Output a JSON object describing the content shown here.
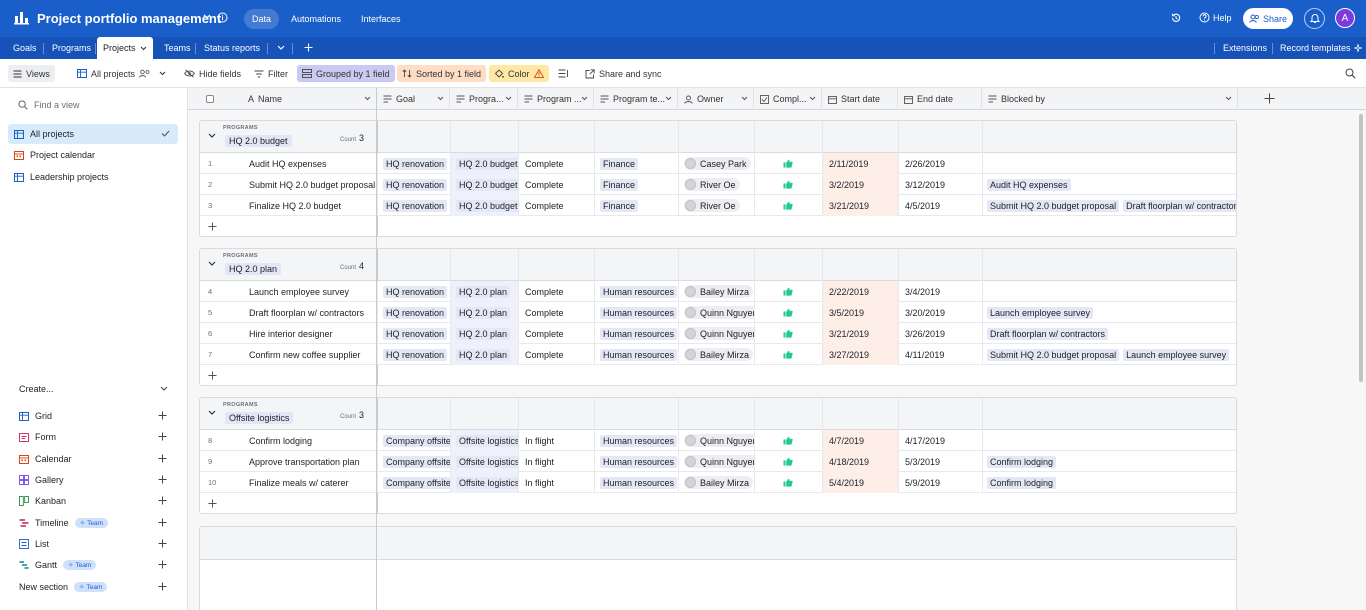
{
  "app": {
    "base_name": "Project portfolio management",
    "top_tabs": [
      "Data",
      "Automations",
      "Interfaces"
    ],
    "help": "Help",
    "share": "Share",
    "avatar_initial": "A",
    "brand_color": "#1a5fc9"
  },
  "table_tabs": {
    "items": [
      "Goals",
      "Programs",
      "Projects",
      "Teams",
      "Status reports"
    ],
    "extensions": "Extensions",
    "record_templates": "Record templates"
  },
  "viewbar": {
    "views": "Views",
    "current_view": "All projects",
    "hide_fields": "Hide fields",
    "filter": "Filter",
    "grouped": "Grouped by 1 field",
    "sorted": "Sorted by 1 field",
    "color": "Color",
    "share_sync": "Share and sync"
  },
  "sidebar": {
    "find_placeholder": "Find a view",
    "views": [
      "All projects",
      "Project calendar",
      "Leadership projects"
    ],
    "create_label": "Create...",
    "create_items": [
      "Grid",
      "Form",
      "Calendar",
      "Gallery",
      "Kanban",
      "Timeline",
      "List",
      "Gantt",
      "New section"
    ],
    "team_badge": "Team"
  },
  "columns": [
    "Name",
    "Goal",
    "Progra...",
    "Program ...",
    "Program te...",
    "Owner",
    "Compl...",
    "Start date",
    "End date",
    "Blocked by"
  ],
  "group_type_label": "PROGRAMS",
  "count_label": "Count",
  "groups": [
    {
      "name": "HQ 2.0 budget",
      "count": "3",
      "rows": [
        {
          "num": "1",
          "name": "Audit HQ expenses",
          "goal": "HQ renovation",
          "program": "HQ 2.0 budget",
          "status": "Complete",
          "team": "Finance",
          "owner": "Casey Park",
          "start": "2/11/2019",
          "end": "2/26/2019",
          "blocked": []
        },
        {
          "num": "2",
          "name": "Submit HQ 2.0 budget proposal",
          "goal": "HQ renovation",
          "program": "HQ 2.0 budget",
          "status": "Complete",
          "team": "Finance",
          "owner": "River Oe",
          "start": "3/2/2019",
          "end": "3/12/2019",
          "blocked": [
            "Audit HQ expenses"
          ]
        },
        {
          "num": "3",
          "name": "Finalize HQ 2.0 budget",
          "goal": "HQ renovation",
          "program": "HQ 2.0 budget",
          "status": "Complete",
          "team": "Finance",
          "owner": "River Oe",
          "start": "3/21/2019",
          "end": "4/5/2019",
          "blocked": [
            "Submit HQ 2.0 budget proposal",
            "Draft floorplan w/ contractors"
          ]
        }
      ]
    },
    {
      "name": "HQ 2.0 plan",
      "count": "4",
      "rows": [
        {
          "num": "4",
          "name": "Launch employee survey",
          "goal": "HQ renovation",
          "program": "HQ 2.0 plan",
          "status": "Complete",
          "team": "Human resources",
          "owner": "Bailey Mirza",
          "start": "2/22/2019",
          "end": "3/4/2019",
          "blocked": []
        },
        {
          "num": "5",
          "name": "Draft floorplan w/ contractors",
          "goal": "HQ renovation",
          "program": "HQ 2.0 plan",
          "status": "Complete",
          "team": "Human resources",
          "owner": "Quinn Nguyer",
          "start": "3/5/2019",
          "end": "3/20/2019",
          "blocked": [
            "Launch employee survey"
          ]
        },
        {
          "num": "6",
          "name": "Hire interior designer",
          "goal": "HQ renovation",
          "program": "HQ 2.0 plan",
          "status": "Complete",
          "team": "Human resources",
          "owner": "Quinn Nguyer",
          "start": "3/21/2019",
          "end": "3/26/2019",
          "blocked": [
            "Draft floorplan w/ contractors"
          ]
        },
        {
          "num": "7",
          "name": "Confirm new coffee supplier",
          "goal": "HQ renovation",
          "program": "HQ 2.0 plan",
          "status": "Complete",
          "team": "Human resources",
          "owner": "Bailey Mirza",
          "start": "3/27/2019",
          "end": "4/11/2019",
          "blocked": [
            "Submit HQ 2.0 budget proposal",
            "Launch employee survey"
          ]
        }
      ]
    },
    {
      "name": "Offsite logistics",
      "count": "3",
      "rows": [
        {
          "num": "8",
          "name": "Confirm lodging",
          "goal": "Company offsite",
          "program": "Offsite logistics",
          "status": "In flight",
          "team": "Human resources",
          "owner": "Quinn Nguyer",
          "start": "4/7/2019",
          "end": "4/17/2019",
          "blocked": []
        },
        {
          "num": "9",
          "name": "Approve transportation plan",
          "goal": "Company offsite",
          "program": "Offsite logistics",
          "status": "In flight",
          "team": "Human resources",
          "owner": "Quinn Nguyer",
          "start": "4/18/2019",
          "end": "5/3/2019",
          "blocked": [
            "Confirm lodging"
          ]
        },
        {
          "num": "10",
          "name": "Finalize meals w/ caterer",
          "goal": "Company offsite",
          "program": "Offsite logistics",
          "status": "In flight",
          "team": "Human resources",
          "owner": "Bailey Mirza",
          "start": "5/4/2019",
          "end": "5/9/2019",
          "blocked": [
            "Confirm lodging"
          ]
        }
      ]
    }
  ]
}
